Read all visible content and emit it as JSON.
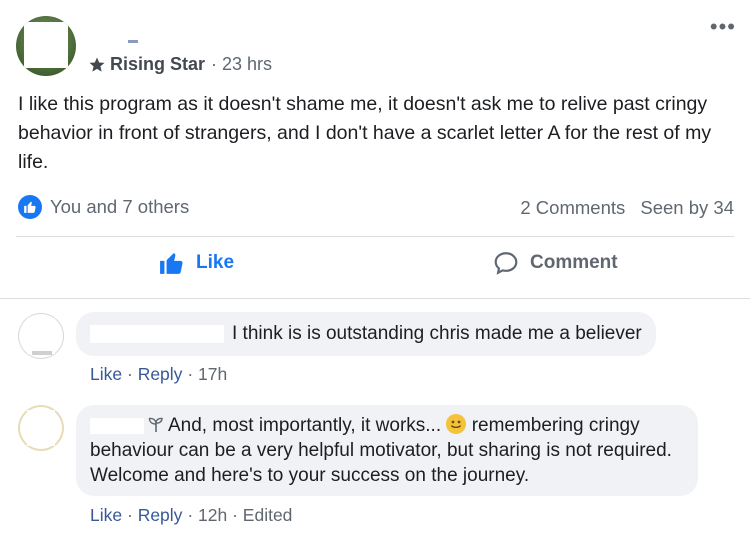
{
  "post": {
    "badge": "Rising Star",
    "time": "· 23 hrs",
    "text": "I like this program as it doesn't shame me, it doesn't ask me to relive past cringy behavior in front of strangers, and I don't have a scarlet letter A for the rest of my life.",
    "reactions_text": "You and 7 others",
    "comments_count": "2 Comments",
    "seen_by": "Seen by 34",
    "like_label": "Like",
    "comment_label": "Comment",
    "more_label": "•••"
  },
  "comments": [
    {
      "text": "I think is is outstanding chris made me a believer",
      "like": "Like",
      "reply": "Reply",
      "time": "17h",
      "edited": ""
    },
    {
      "text_part1": "And, most importantly, it works...",
      "text_part2": "remembering cringy behaviour can be a very helpful motivator, but sharing is not required. Welcome and here's to your success on the journey.",
      "like": "Like",
      "reply": "Reply",
      "time": "12h",
      "edited": "Edited"
    }
  ],
  "colors": {
    "accent": "#1877f2",
    "link": "#385898",
    "muted": "#606770",
    "bubble": "#f0f2f5"
  }
}
